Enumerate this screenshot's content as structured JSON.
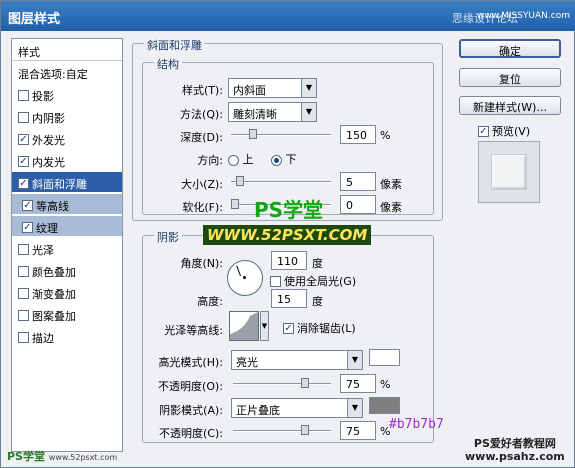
{
  "window": {
    "title": "图层样式",
    "watermark": "思缘设计论坛",
    "watermark_url": "www.MISSYUAN.com"
  },
  "left_panel": {
    "header": "样式",
    "items": [
      {
        "label": "混合选项:自定",
        "checkbox": false,
        "checked": false
      },
      {
        "label": "投影",
        "checkbox": true,
        "checked": false
      },
      {
        "label": "内阴影",
        "checkbox": true,
        "checked": false
      },
      {
        "label": "外发光",
        "checkbox": true,
        "checked": true
      },
      {
        "label": "内发光",
        "checkbox": true,
        "checked": true
      },
      {
        "label": "斜面和浮雕",
        "checkbox": true,
        "checked": true,
        "selected": true
      },
      {
        "label": "等高线",
        "checkbox": true,
        "checked": true,
        "sub": true
      },
      {
        "label": "纹理",
        "checkbox": true,
        "checked": true,
        "sub": true
      },
      {
        "label": "光泽",
        "checkbox": true,
        "checked": false
      },
      {
        "label": "颜色叠加",
        "checkbox": true,
        "checked": false
      },
      {
        "label": "渐变叠加",
        "checkbox": true,
        "checked": false
      },
      {
        "label": "图案叠加",
        "checkbox": true,
        "checked": false
      },
      {
        "label": "描边",
        "checkbox": true,
        "checked": false
      }
    ]
  },
  "bevel": {
    "group_title": "斜面和浮雕",
    "structure_title": "结构",
    "style_label": "样式(T):",
    "style_value": "内斜面",
    "technique_label": "方法(Q):",
    "technique_value": "雕刻清晰",
    "depth_label": "深度(D):",
    "depth_value": "150",
    "depth_unit": "%",
    "depth_level": 0.2,
    "direction_label": "方向:",
    "direction_up": "上",
    "direction_down": "下",
    "direction_selected": "下",
    "size_label": "大小(Z):",
    "size_value": "5",
    "size_unit": "像素",
    "size_level": 0.05,
    "soften_label": "软化(F):",
    "soften_value": "0",
    "soften_unit": "像素",
    "soften_level": 0
  },
  "shading": {
    "group_title": "阴影",
    "angle_label": "角度(N):",
    "angle_value": "110",
    "angle_unit": "度",
    "global_light_label": "使用全局光(G)",
    "global_light_checked": false,
    "altitude_label": "高度:",
    "altitude_value": "15",
    "altitude_unit": "度",
    "gloss_label": "光泽等高线:",
    "antialias_label": "消除锯齿(L)",
    "antialias_checked": true,
    "highlight_label": "高光模式(H):",
    "highlight_mode": "亮光",
    "highlight_color": "#ffffff",
    "hl_opacity_label": "不透明度(O):",
    "hl_opacity_value": "75",
    "hl_opacity_unit": "%",
    "hl_opacity_level": 0.75,
    "shadow_label": "阴影模式(A):",
    "shadow_mode": "正片叠底",
    "shadow_color": "#7e7e7e",
    "sh_opacity_label": "不透明度(C):",
    "sh_opacity_value": "75",
    "sh_opacity_unit": "%",
    "sh_opacity_level": 0.75
  },
  "buttons": {
    "ok": "确定",
    "reset": "复位",
    "new_style": "新建样式(W)...",
    "preview": "预览(V)",
    "preview_checked": true
  },
  "overlays": {
    "ps_xuetang": "PS学堂",
    "site": "WWW.52PSXT.COM",
    "hex": "#b7b7b7",
    "bottom_left": "PS学堂",
    "bottom_left_url": "www.52psxt.com",
    "bottom_right_1": "PS爱好者教程网",
    "bottom_right_2": "www.psahz.com"
  }
}
